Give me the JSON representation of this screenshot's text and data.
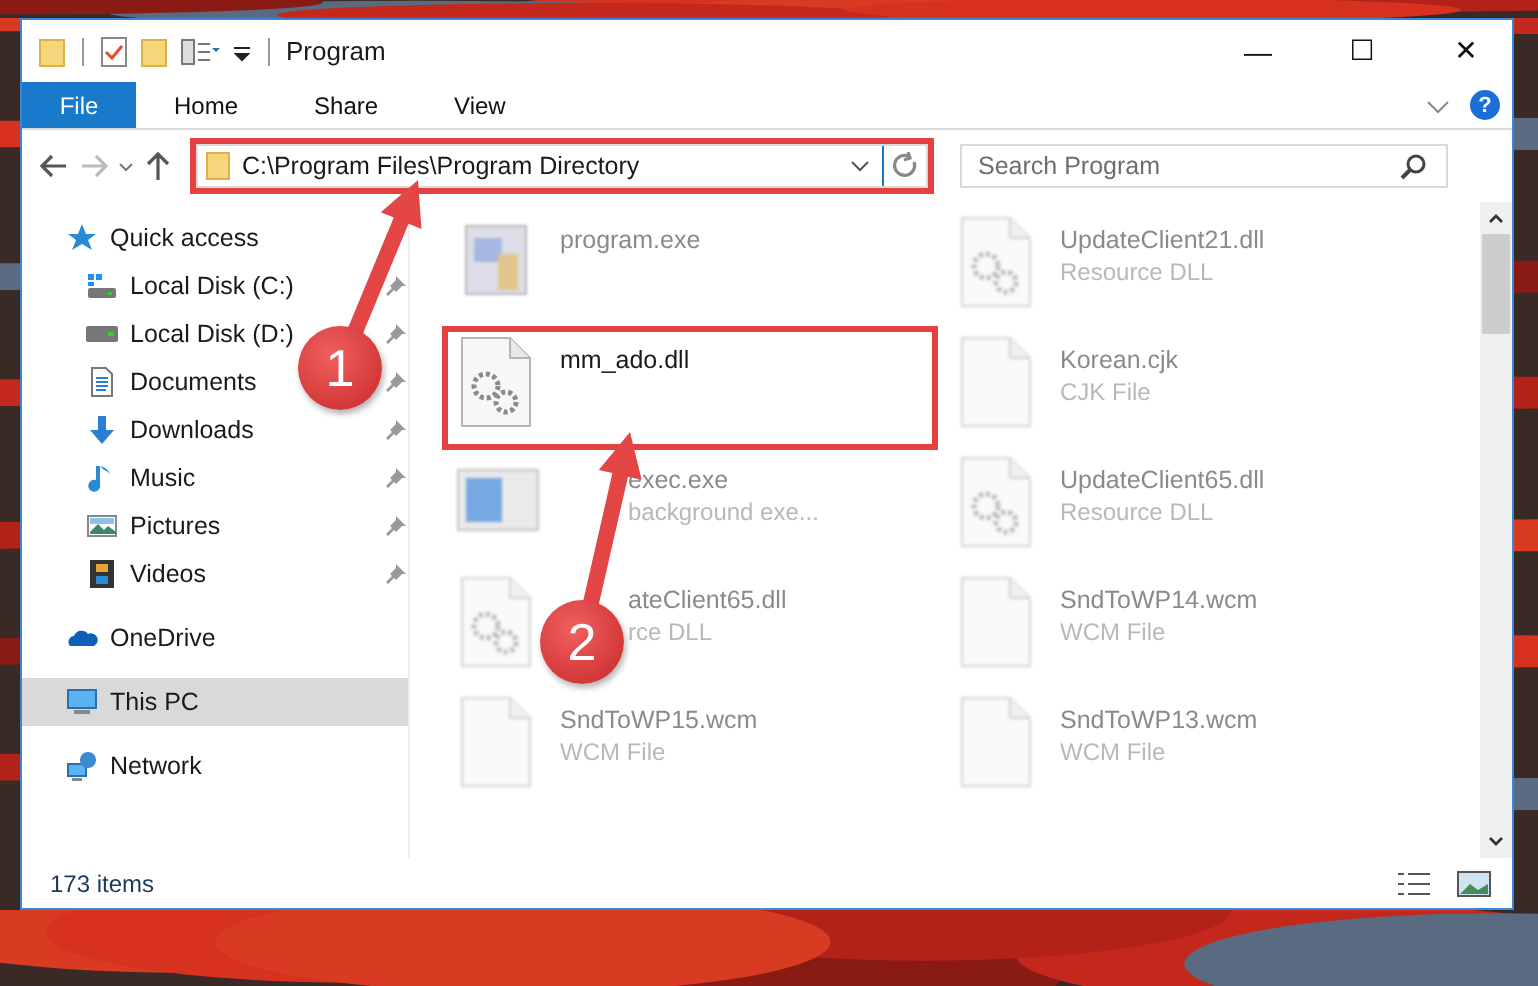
{
  "window": {
    "title": "Program",
    "minimize": "—",
    "maximize": "☐",
    "close": "✕"
  },
  "ribbon": {
    "tabs": [
      {
        "label": "File",
        "kind": "file"
      },
      {
        "label": "Home",
        "kind": "tab"
      },
      {
        "label": "Share",
        "kind": "tab"
      },
      {
        "label": "View",
        "kind": "tab"
      }
    ],
    "help": "?"
  },
  "address": {
    "path": "C:\\Program Files\\Program Directory"
  },
  "search": {
    "placeholder": "Search Program"
  },
  "nav": {
    "sections": [
      {
        "label": "Quick access",
        "kind": "star",
        "selected": false,
        "children": [
          {
            "label": "Local Disk (C:)",
            "kind": "system_drive",
            "pinned": true,
            "selected": false
          },
          {
            "label": "Local Disk (D:)",
            "kind": "drive",
            "pinned": true,
            "selected": false
          },
          {
            "label": "Documents",
            "kind": "documents",
            "pinned": true,
            "selected": false
          },
          {
            "label": "Downloads",
            "kind": "downloads",
            "pinned": true,
            "selected": false
          },
          {
            "label": "Music",
            "kind": "music",
            "pinned": true,
            "selected": false
          },
          {
            "label": "Pictures",
            "kind": "pictures",
            "pinned": true,
            "selected": false
          },
          {
            "label": "Videos",
            "kind": "videos",
            "pinned": true,
            "selected": false
          }
        ]
      },
      {
        "label": "OneDrive",
        "kind": "cloud",
        "selected": false
      },
      {
        "label": "This PC",
        "kind": "pc",
        "selected": true
      },
      {
        "label": "Network",
        "kind": "network",
        "selected": false
      }
    ]
  },
  "files": [
    {
      "name": "program.exe",
      "kind": "app",
      "blurred": true,
      "covered": false
    },
    {
      "name": "UpdateClient21.dll",
      "type": "Resource DLL",
      "kind": "dll",
      "blurred": true,
      "covered": false
    },
    {
      "name": "mm_ado.dll",
      "kind": "dll",
      "blurred": false,
      "covered": false
    },
    {
      "name": "Korean.cjk",
      "type": "CJK File",
      "kind": "blank",
      "blurred": true,
      "covered": false
    },
    {
      "name": "exec.exe",
      "type": "background exe...",
      "kind": "window",
      "blurred": true,
      "covered": true
    },
    {
      "name": "UpdateClient65.dll",
      "type": "Resource DLL",
      "kind": "dll",
      "blurred": true,
      "covered": false
    },
    {
      "name": "ateClient65.dll",
      "type": "rce DLL",
      "kind": "dll",
      "blurred": true,
      "covered": true
    },
    {
      "name": "SndToWP14.wcm",
      "type": "WCM File",
      "kind": "blank",
      "blurred": true,
      "covered": false
    },
    {
      "name": "SndToWP15.wcm",
      "type": "WCM File",
      "kind": "blank",
      "blurred": true,
      "covered": false
    },
    {
      "name": "SndToWP13.wcm",
      "type": "WCM File",
      "kind": "blank",
      "blurred": true,
      "covered": false
    }
  ],
  "status_bar": {
    "count": "173 items"
  },
  "annotations": [
    {
      "number": "1"
    },
    {
      "number": "2"
    }
  ]
}
